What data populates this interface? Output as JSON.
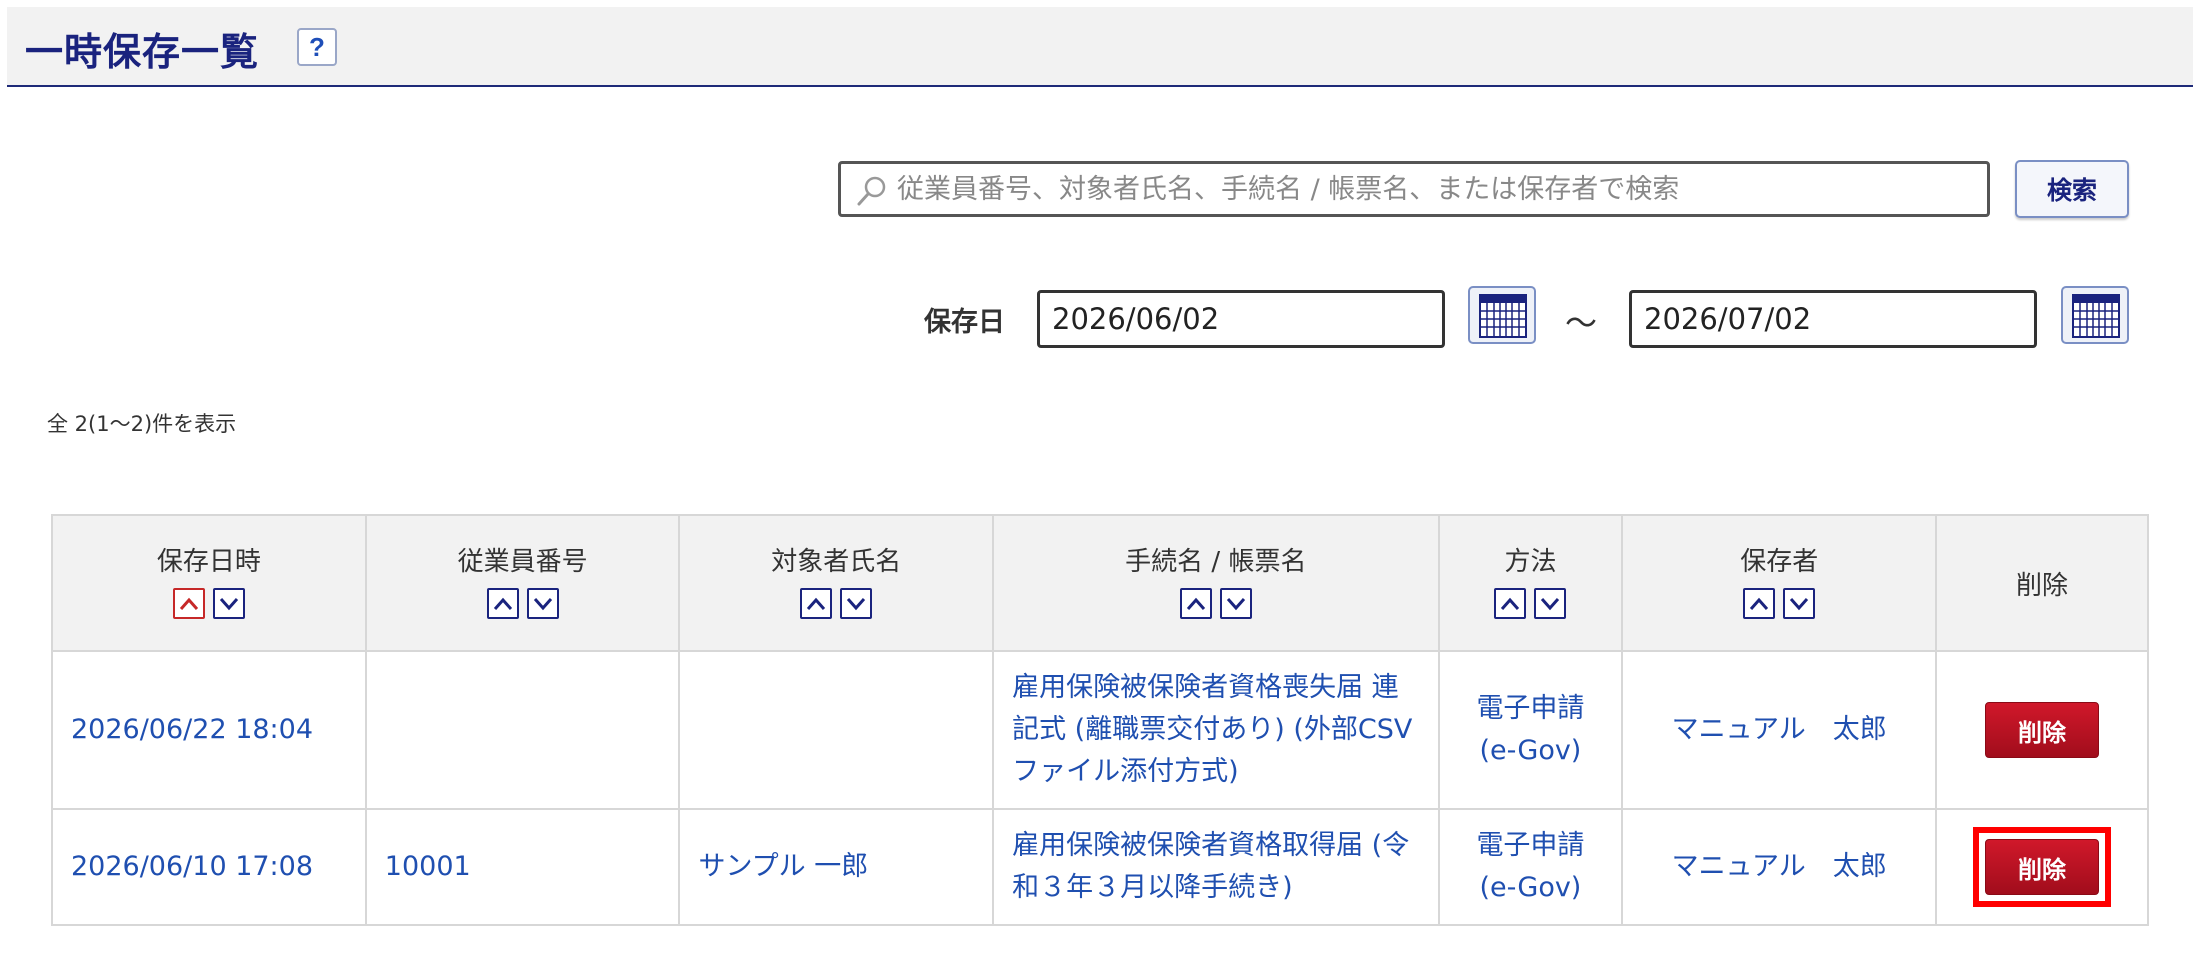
{
  "header": {
    "title": "一時保存一覧",
    "help_label": "?"
  },
  "search": {
    "placeholder": "従業員番号、対象者氏名、手続名 / 帳票名、または保存者で検索",
    "value": "",
    "button_label": "検索"
  },
  "date_filter": {
    "label": "保存日",
    "from": "2026/06/02",
    "separator": "～",
    "to": "2026/07/02"
  },
  "result_count": "全 2(1～2)件を表示",
  "table": {
    "columns": [
      {
        "label": "保存日時",
        "sortable": true,
        "active_sort": "asc"
      },
      {
        "label": "従業員番号",
        "sortable": true
      },
      {
        "label": "対象者氏名",
        "sortable": true
      },
      {
        "label": "手続名 / 帳票名",
        "sortable": true
      },
      {
        "label": "方法",
        "sortable": true
      },
      {
        "label": "保存者",
        "sortable": true
      },
      {
        "label": "削除",
        "sortable": false
      }
    ],
    "rows": [
      {
        "saved_at": "2026/06/22 18:04",
        "employee_no": "",
        "target_name": "",
        "procedure": "雇用保険被保険者資格喪失届 連記式 (離職票交付あり) (外部CSVファイル添付方式)",
        "method": "電子申請 (e-Gov)",
        "saved_by": "マニュアル　太郎",
        "delete_label": "削除"
      },
      {
        "saved_at": "2026/06/10 17:08",
        "employee_no": "10001",
        "target_name": "サンプル 一郎",
        "procedure": "雇用保険被保険者資格取得届 (令和３年３月以降手続き)",
        "method": "電子申請 (e-Gov)",
        "saved_by": "マニュアル　太郎",
        "delete_label": "削除"
      }
    ]
  },
  "colors": {
    "title": "#1a237e",
    "link": "#1f4fb0",
    "delete": "#b71c1c",
    "highlight": "#ff0000"
  },
  "icons": {
    "search": "search-icon",
    "calendar": "calendar-icon",
    "sort_up": "chevron-up-icon",
    "sort_down": "chevron-down-icon"
  }
}
